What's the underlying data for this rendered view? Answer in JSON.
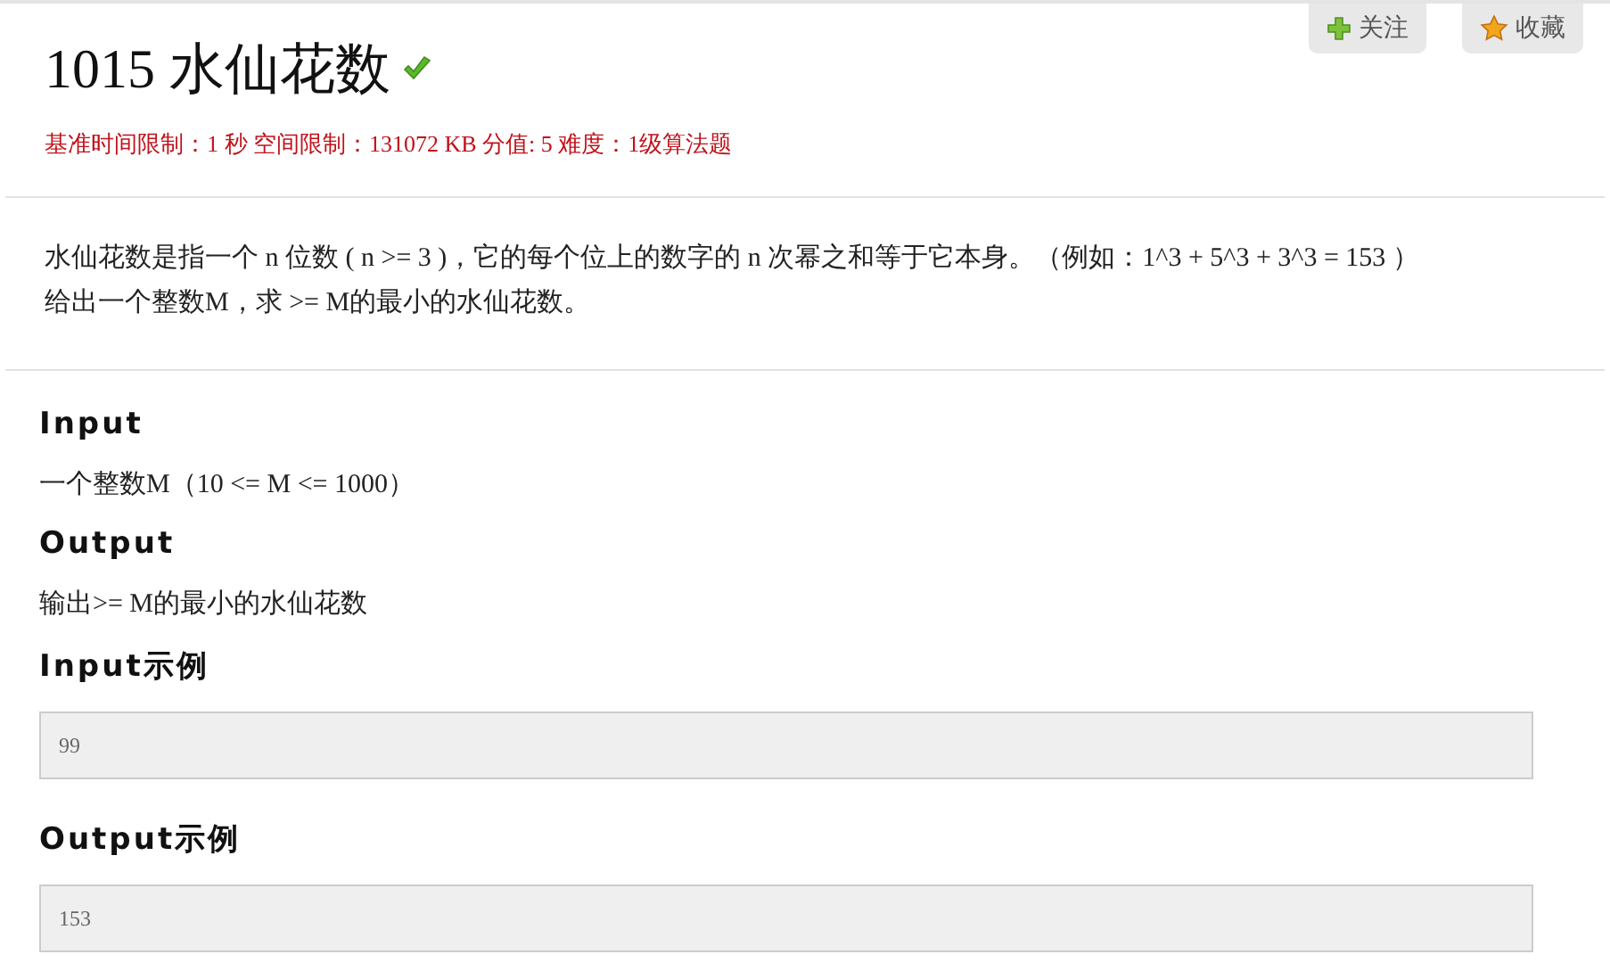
{
  "problem": {
    "title": "1015 水仙花数",
    "solved": true,
    "meta": "基准时间限制：1 秒 空间限制：131072 KB 分值: 5 难度：1级算法题"
  },
  "actions": [
    {
      "kind": "follow",
      "label": "关注"
    },
    {
      "kind": "favorite",
      "label": "收藏"
    }
  ],
  "description": [
    "水仙花数是指一个 n 位数 ( n >= 3 )，它的每个位上的数字的 n 次幂之和等于它本身。（例如：1^3 + 5^3 + 3^3 = 153 ）",
    "给出一个整数M，求 >= M的最小的水仙花数。"
  ],
  "sections": [
    {
      "kind": "text",
      "heading": "Input",
      "body": "一个整数M（10 <= M <= 1000）"
    },
    {
      "kind": "text",
      "heading": "Output",
      "body": "输出>= M的最小的水仙花数"
    },
    {
      "kind": "sample",
      "heading": "Input示例",
      "body": "99"
    },
    {
      "kind": "sample",
      "heading": "Output示例",
      "body": "153"
    }
  ]
}
